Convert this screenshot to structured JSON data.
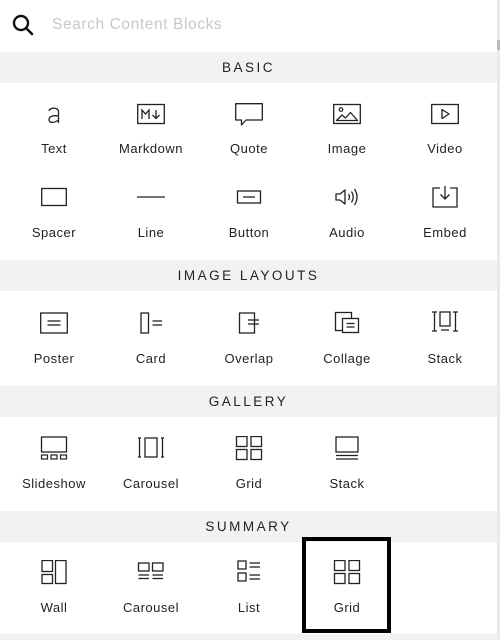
{
  "search": {
    "placeholder": "Search Content Blocks",
    "icon": "search-icon"
  },
  "sections": [
    {
      "title": "BASIC",
      "items": [
        {
          "label": "Text",
          "icon": "text-icon"
        },
        {
          "label": "Markdown",
          "icon": "markdown-icon"
        },
        {
          "label": "Quote",
          "icon": "quote-icon"
        },
        {
          "label": "Image",
          "icon": "image-icon"
        },
        {
          "label": "Video",
          "icon": "video-icon"
        },
        {
          "label": "Spacer",
          "icon": "spacer-icon"
        },
        {
          "label": "Line",
          "icon": "line-icon"
        },
        {
          "label": "Button",
          "icon": "button-icon"
        },
        {
          "label": "Audio",
          "icon": "audio-icon"
        },
        {
          "label": "Embed",
          "icon": "embed-icon"
        }
      ]
    },
    {
      "title": "IMAGE LAYOUTS",
      "items": [
        {
          "label": "Poster",
          "icon": "poster-icon"
        },
        {
          "label": "Card",
          "icon": "card-icon"
        },
        {
          "label": "Overlap",
          "icon": "overlap-icon"
        },
        {
          "label": "Collage",
          "icon": "collage-icon"
        },
        {
          "label": "Stack",
          "icon": "stack-icon"
        }
      ]
    },
    {
      "title": "GALLERY",
      "items": [
        {
          "label": "Slideshow",
          "icon": "slideshow-icon"
        },
        {
          "label": "Carousel",
          "icon": "carousel-icon"
        },
        {
          "label": "Grid",
          "icon": "grid-icon"
        },
        {
          "label": "Stack",
          "icon": "gallery-stack-icon"
        }
      ]
    },
    {
      "title": "SUMMARY",
      "items": [
        {
          "label": "Wall",
          "icon": "wall-icon"
        },
        {
          "label": "Carousel",
          "icon": "summary-carousel-icon"
        },
        {
          "label": "List",
          "icon": "list-icon"
        },
        {
          "label": "Grid",
          "icon": "summary-grid-icon",
          "highlighted": true
        }
      ]
    }
  ]
}
